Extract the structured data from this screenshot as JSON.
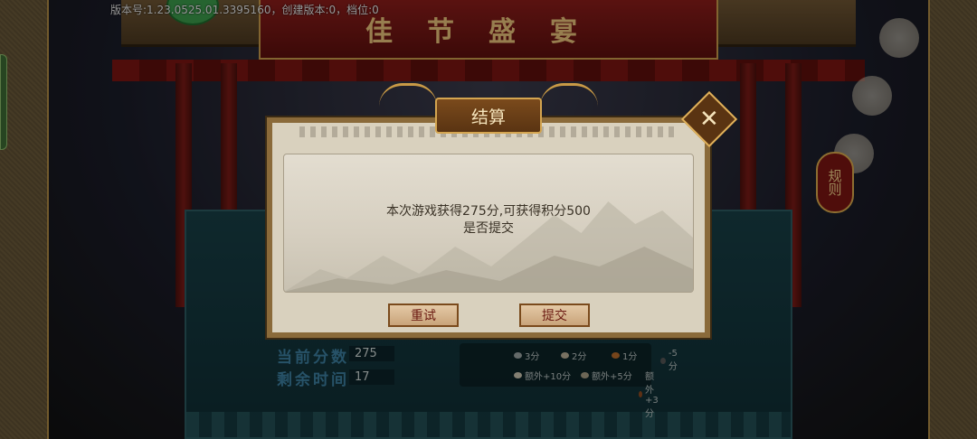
{
  "header": {
    "version_text": "版本号:1.23.0525.01.3395160，创建版本:0，档位:0",
    "banner_title": "佳节盛宴"
  },
  "side": {
    "rules_label": "规则"
  },
  "stats": {
    "current_score_label": "当前分数",
    "current_score_value": "275",
    "time_left_label": "剩余时间",
    "time_left_value": "17"
  },
  "legend": {
    "items": [
      "3分",
      "2分",
      "1分",
      "-5分",
      "额外+10分",
      "额外+5分",
      "额外+3分"
    ]
  },
  "dialog": {
    "title": "结算",
    "message_line1": "本次游戏获得275分,可获得积分500",
    "message_line2": "是否提交",
    "retry_label": "重试",
    "submit_label": "提交",
    "close_symbol": "✕"
  },
  "colors": {
    "dialog_bg": "#d9d1be",
    "accent_gold": "#d4a550",
    "banner_red": "#8a1d1a",
    "button_text": "#6b1a12"
  }
}
